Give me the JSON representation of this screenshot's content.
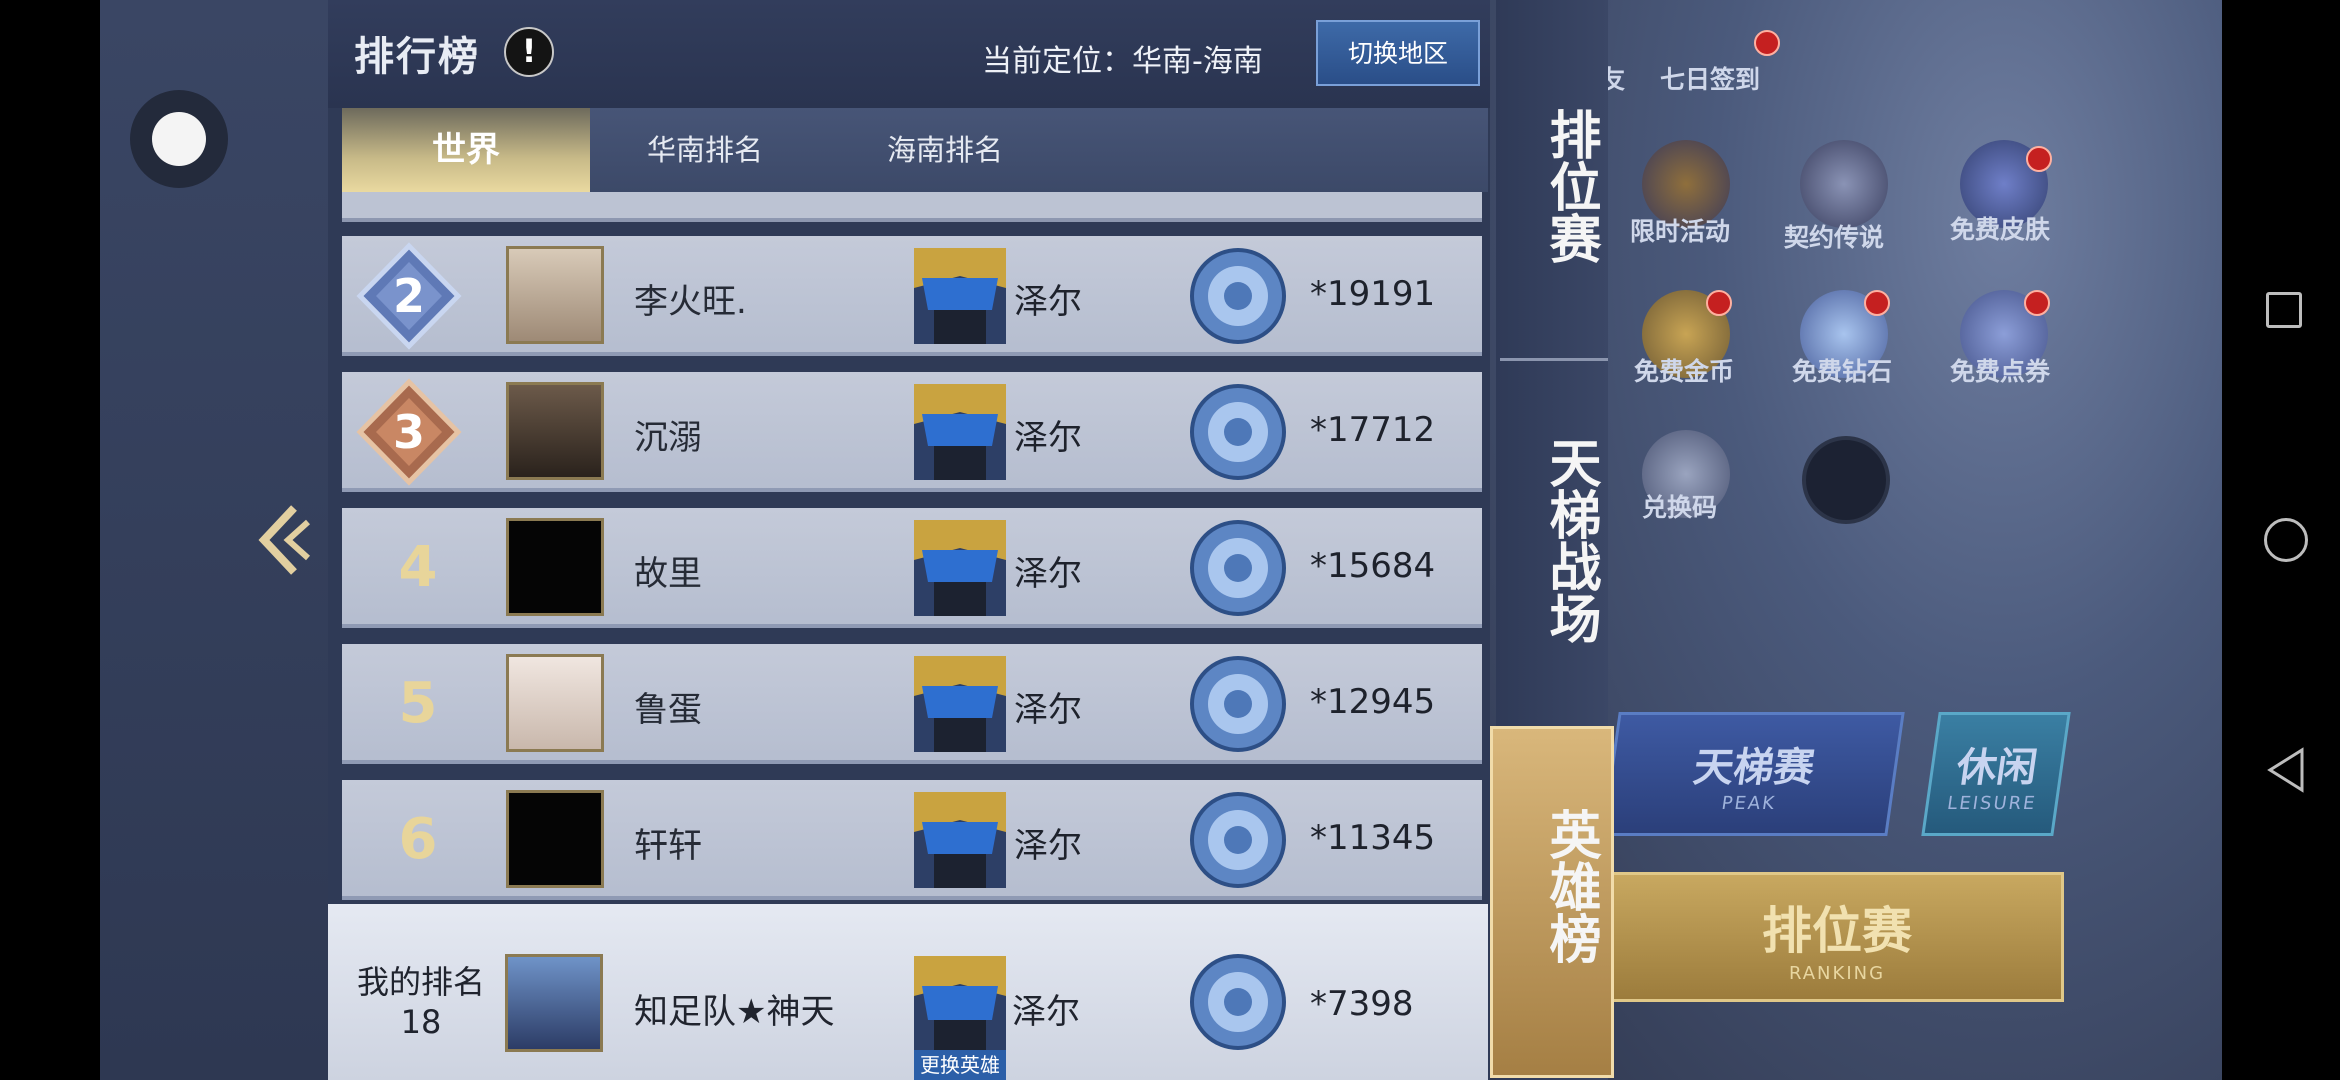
{
  "header": {
    "title": "排行榜",
    "info_symbol": "!",
    "location": "当前定位：华南-海南",
    "switch_region_label": "切换地区"
  },
  "tabs": [
    {
      "label": "世界",
      "active": true
    },
    {
      "label": "华南排名",
      "active": false
    },
    {
      "label": "海南排名",
      "active": false
    }
  ],
  "rows": [
    {
      "rank": "2",
      "medal": "silver",
      "name": "李火旺.",
      "hero": "泽尔",
      "score": "*19191"
    },
    {
      "rank": "3",
      "medal": "bronze",
      "name": "沉溺",
      "hero": "泽尔",
      "score": "*17712"
    },
    {
      "rank": "4",
      "medal": "none",
      "name": "故里",
      "hero": "泽尔",
      "score": "*15684"
    },
    {
      "rank": "5",
      "medal": "none",
      "name": "鲁蛋",
      "hero": "泽尔",
      "score": "*12945"
    },
    {
      "rank": "6",
      "medal": "none",
      "name": "轩轩",
      "hero": "泽尔",
      "score": "*11345"
    }
  ],
  "my_rank": {
    "label": "我的排名",
    "rank": "18",
    "name": "知足队★神天",
    "hero": "泽尔",
    "change_hero_label": "更换英雄",
    "score": "*7398"
  },
  "side_menu": [
    {
      "label": "排位赛",
      "active": false
    },
    {
      "label": "天梯战场",
      "active": false
    },
    {
      "label": "英雄榜",
      "active": true
    }
  ],
  "game_bg": {
    "top_labels": [
      "友",
      "七日签到"
    ],
    "icons": [
      "限时活动",
      "契约传说",
      "免费皮肤",
      "免费金币",
      "免费钻石",
      "免费点券",
      "兑换码"
    ],
    "ladder": {
      "title": "天梯赛",
      "sub": "PEAK"
    },
    "leisure": {
      "title": "休闲",
      "sub": "LEISURE"
    },
    "ranking": {
      "title": "排位赛",
      "sub": "RANKING"
    }
  },
  "colors": {
    "accent_gold": "#d9b77b",
    "switch_button": "#2a4e88",
    "row_bg": "#c4cad9"
  }
}
